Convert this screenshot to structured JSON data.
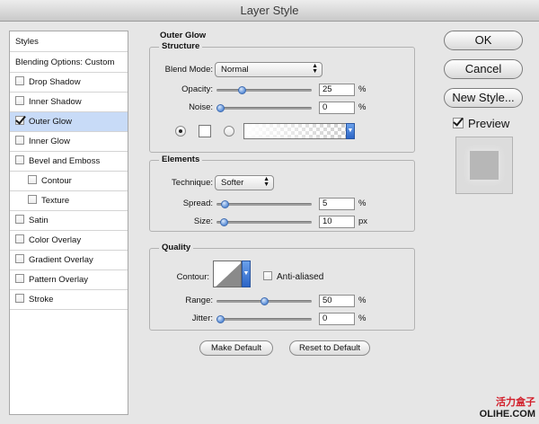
{
  "window": {
    "title": "Layer Style"
  },
  "styles_list": {
    "header": "Styles",
    "blending": "Blending Options: Custom",
    "items": [
      {
        "label": "Drop Shadow",
        "checked": false,
        "indent": false
      },
      {
        "label": "Inner Shadow",
        "checked": false,
        "indent": false
      },
      {
        "label": "Outer Glow",
        "checked": true,
        "indent": false,
        "selected": true
      },
      {
        "label": "Inner Glow",
        "checked": false,
        "indent": false
      },
      {
        "label": "Bevel and Emboss",
        "checked": false,
        "indent": false
      },
      {
        "label": "Contour",
        "checked": false,
        "indent": true
      },
      {
        "label": "Texture",
        "checked": false,
        "indent": true
      },
      {
        "label": "Satin",
        "checked": false,
        "indent": false
      },
      {
        "label": "Color Overlay",
        "checked": false,
        "indent": false
      },
      {
        "label": "Gradient Overlay",
        "checked": false,
        "indent": false
      },
      {
        "label": "Pattern Overlay",
        "checked": false,
        "indent": false
      },
      {
        "label": "Stroke",
        "checked": false,
        "indent": false
      }
    ]
  },
  "outer_glow": {
    "title": "Outer Glow",
    "structure": {
      "title": "Structure",
      "blend_mode_label": "Blend Mode:",
      "blend_mode": "Normal",
      "opacity_label": "Opacity:",
      "opacity": "25",
      "opacity_level": 0.25,
      "noise_label": "Noise:",
      "noise": "0",
      "noise_level": 0,
      "unit_percent": "%",
      "fill_mode": "color"
    },
    "elements": {
      "title": "Elements",
      "technique_label": "Technique:",
      "technique": "Softer",
      "spread_label": "Spread:",
      "spread": "5",
      "spread_level": 0.05,
      "size_label": "Size:",
      "size": "10",
      "size_level": 0.04,
      "unit_percent": "%",
      "unit_px": "px"
    },
    "quality": {
      "title": "Quality",
      "contour_label": "Contour:",
      "anti_aliased_label": "Anti-aliased",
      "anti_aliased": false,
      "range_label": "Range:",
      "range": "50",
      "range_level": 0.5,
      "jitter_label": "Jitter:",
      "jitter": "0",
      "jitter_level": 0,
      "unit_percent": "%"
    },
    "make_default": "Make Default",
    "reset_default": "Reset to Default"
  },
  "actions": {
    "ok": "OK",
    "cancel": "Cancel",
    "new_style": "New Style...",
    "preview_label": "Preview",
    "preview_checked": true
  },
  "watermark": {
    "cn": "活力盒子",
    "en": "OLIHE.COM"
  },
  "colors": {
    "selection": "#c8dbf7",
    "thumb": "#5c8fd8",
    "accent": "#2c65c6"
  }
}
